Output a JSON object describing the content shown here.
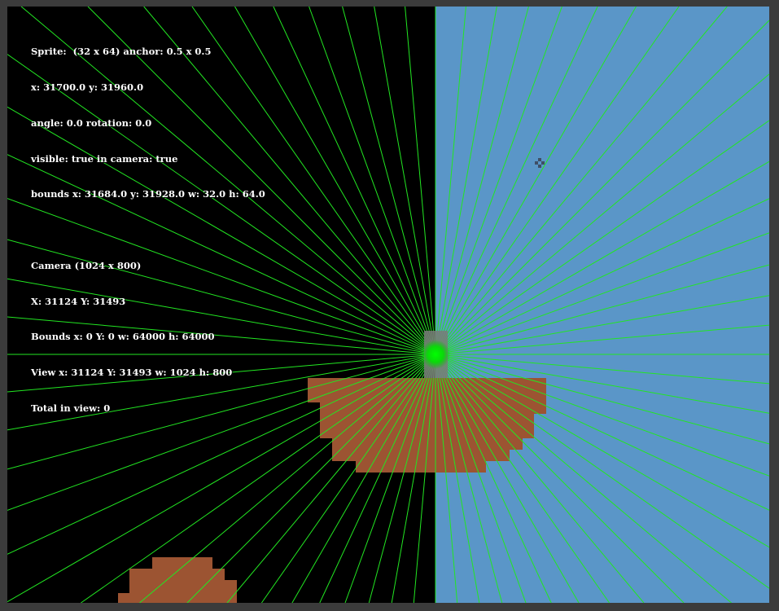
{
  "debug": {
    "sprite_lines": [
      "Sprite:  (32 x 64) anchor: 0.5 x 0.5",
      "x: 31700.0 y: 31960.0",
      "angle: 0.0 rotation: 0.0",
      "visible: true in camera: true",
      "bounds x: 31684.0 y: 31928.0 w: 32.0 h: 64.0"
    ],
    "camera_lines": [
      "Camera (1024 x 800)",
      "X: 31124 Y: 31493",
      "Bounds x: 0 Y: 0 w: 64000 h: 64000",
      "View x: 31124 Y: 31493 w: 1024 h: 800",
      "Total in view: 0"
    ]
  },
  "colors": {
    "frame": "#3b3b3b",
    "void": "#000000",
    "sky": "#5a96c8",
    "ground": "#9c5432",
    "rays": "#22e622",
    "player_glow": "#00ff00",
    "player_box": "#7a7a7a",
    "crosshair": "#3f4f66"
  },
  "icons": {
    "crosshair": "move-cursor-icon",
    "player": "player-sprite-icon"
  }
}
